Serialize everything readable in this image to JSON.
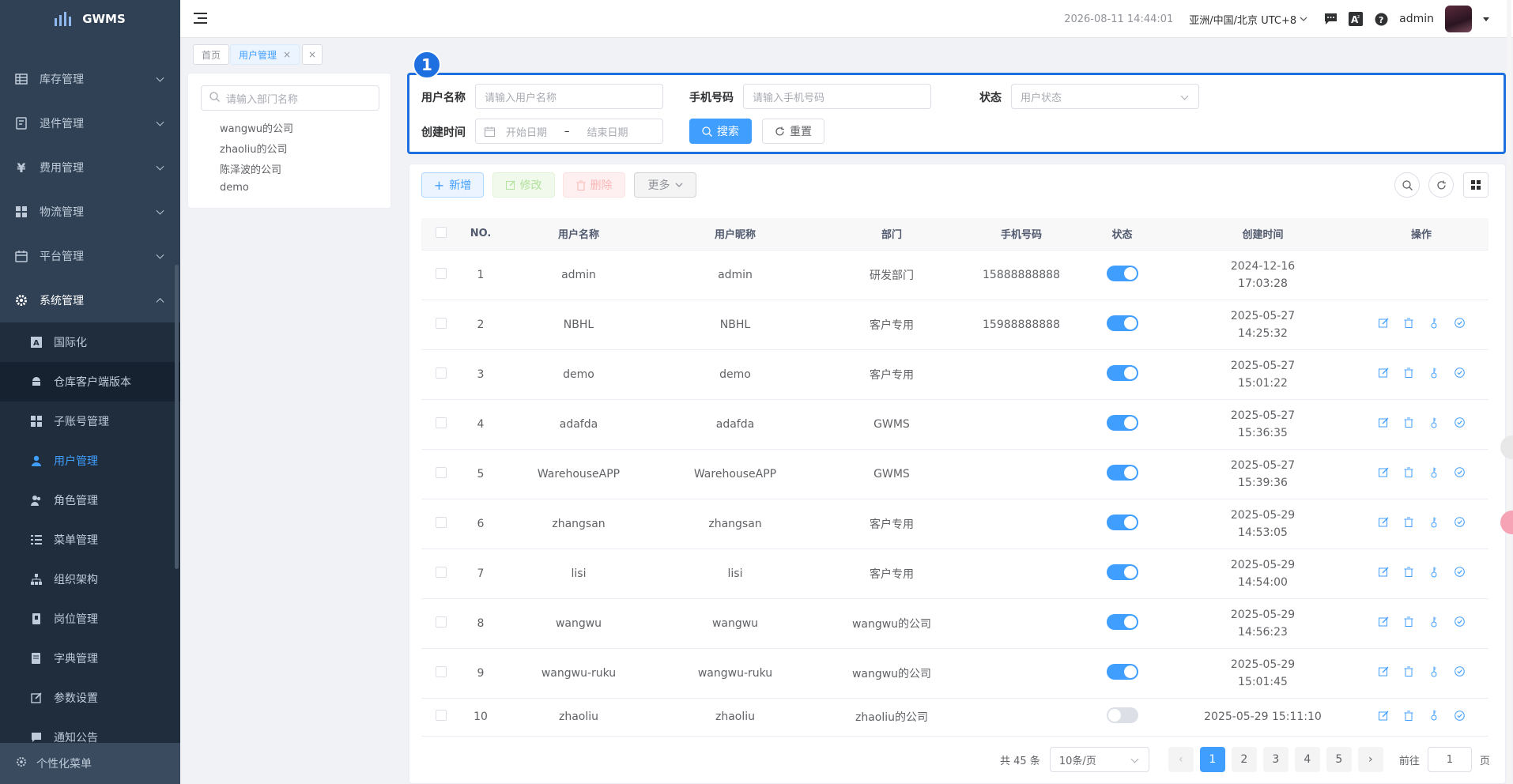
{
  "app": {
    "name": "GWMS"
  },
  "sidebar": {
    "top_items": [
      {
        "label": "库存管理",
        "icon": "table-icon"
      },
      {
        "label": "退件管理",
        "icon": "return-icon"
      },
      {
        "label": "费用管理",
        "icon": "yen-icon"
      },
      {
        "label": "物流管理",
        "icon": "grid-icon"
      },
      {
        "label": "平台管理",
        "icon": "calendar-icon"
      },
      {
        "label": "系统管理",
        "icon": "gear-icon"
      }
    ],
    "sub_items": [
      {
        "label": "国际化",
        "icon": "translate-icon"
      },
      {
        "label": "仓库客户端版本",
        "icon": "android-icon"
      },
      {
        "label": "子账号管理",
        "icon": "grid-icon"
      },
      {
        "label": "用户管理",
        "icon": "user-icon"
      },
      {
        "label": "角色管理",
        "icon": "users-icon"
      },
      {
        "label": "菜单管理",
        "icon": "list-icon"
      },
      {
        "label": "组织架构",
        "icon": "tree-icon"
      },
      {
        "label": "岗位管理",
        "icon": "badge-icon"
      },
      {
        "label": "字典管理",
        "icon": "dict-icon"
      },
      {
        "label": "参数设置",
        "icon": "edit-icon"
      },
      {
        "label": "通知公告",
        "icon": "message-icon"
      }
    ],
    "bottom": "个性化菜单"
  },
  "header": {
    "datetime": "2026-08-11 14:44:01",
    "timezone": "亚洲/中国/北京 UTC+8",
    "user": "admin"
  },
  "tags": {
    "home": "首页",
    "current": "用户管理"
  },
  "dept": {
    "placeholder": "请输入部门名称",
    "nodes": [
      "wangwu的公司",
      "zhaoliu的公司",
      "陈泽波的公司",
      "demo"
    ]
  },
  "badge": "1",
  "search": {
    "username_label": "用户名称",
    "username_placeholder": "请输入用户名称",
    "phone_label": "手机号码",
    "phone_placeholder": "请输入手机号码",
    "status_label": "状态",
    "status_placeholder": "用户状态",
    "created_label": "创建时间",
    "start_placeholder": "开始日期",
    "dash": "–",
    "end_placeholder": "结束日期",
    "search_btn": "搜索",
    "reset_btn": "重置"
  },
  "toolbar": {
    "add": "新增",
    "edit": "修改",
    "delete": "删除",
    "more": "更多"
  },
  "table": {
    "headers": [
      "NO.",
      "用户名称",
      "用户昵称",
      "部门",
      "手机号码",
      "状态",
      "创建时间",
      "操作"
    ],
    "rows": [
      {
        "no": "1",
        "username": "admin",
        "nickname": "admin",
        "dept": "研发部门",
        "phone": "15888888888",
        "status": true,
        "date": "2024-12-16",
        "time": "17:03:28",
        "ops": false
      },
      {
        "no": "2",
        "username": "NBHL",
        "nickname": "NBHL",
        "dept": "客户专用",
        "phone": "15988888888",
        "status": true,
        "date": "2025-05-27",
        "time": "14:25:32",
        "ops": true
      },
      {
        "no": "3",
        "username": "demo",
        "nickname": "demo",
        "dept": "客户专用",
        "phone": "",
        "status": true,
        "date": "2025-05-27",
        "time": "15:01:22",
        "ops": true
      },
      {
        "no": "4",
        "username": "adafda",
        "nickname": "adafda",
        "dept": "GWMS",
        "phone": "",
        "status": true,
        "date": "2025-05-27",
        "time": "15:36:35",
        "ops": true
      },
      {
        "no": "5",
        "username": "WarehouseAPP",
        "nickname": "WarehouseAPP",
        "dept": "GWMS",
        "phone": "",
        "status": true,
        "date": "2025-05-27",
        "time": "15:39:36",
        "ops": true
      },
      {
        "no": "6",
        "username": "zhangsan",
        "nickname": "zhangsan",
        "dept": "客户专用",
        "phone": "",
        "status": true,
        "date": "2025-05-29",
        "time": "14:53:05",
        "ops": true
      },
      {
        "no": "7",
        "username": "lisi",
        "nickname": "lisi",
        "dept": "客户专用",
        "phone": "",
        "status": true,
        "date": "2025-05-29",
        "time": "14:54:00",
        "ops": true
      },
      {
        "no": "8",
        "username": "wangwu",
        "nickname": "wangwu",
        "dept": "wangwu的公司",
        "phone": "",
        "status": true,
        "date": "2025-05-29",
        "time": "14:56:23",
        "ops": true
      },
      {
        "no": "9",
        "username": "wangwu-ruku",
        "nickname": "wangwu-ruku",
        "dept": "wangwu的公司",
        "phone": "",
        "status": true,
        "date": "2025-05-29",
        "time": "15:01:45",
        "ops": true
      },
      {
        "no": "10",
        "username": "zhaoliu",
        "nickname": "zhaoliu",
        "dept": "zhaoliu的公司",
        "phone": "",
        "status": false,
        "date": "2025-05-29 15:11:10",
        "time": "",
        "ops": true
      }
    ]
  },
  "pagination": {
    "total": "共 45 条",
    "page_size": "10条/页",
    "pages": [
      "1",
      "2",
      "3",
      "4",
      "5"
    ],
    "current": "1",
    "goto_label": "前往",
    "goto_value": "1",
    "page_suffix": "页"
  },
  "colors": {
    "primary": "#409eff",
    "sidebar_bg": "#304156",
    "highlight_border": "#1e6fe0"
  }
}
